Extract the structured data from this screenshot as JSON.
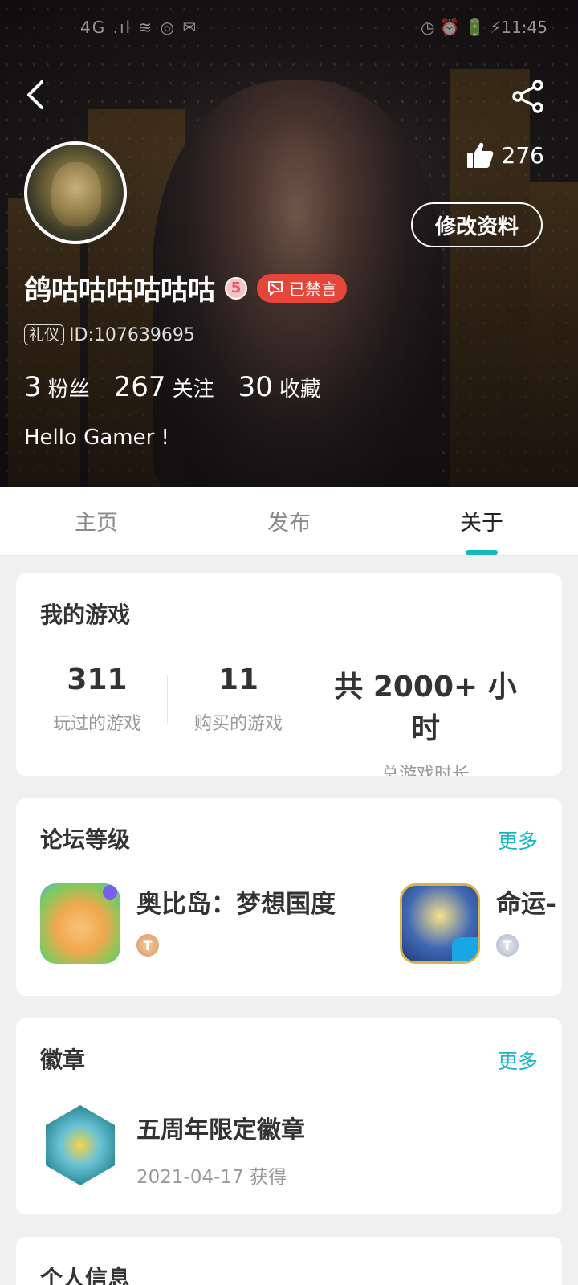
{
  "status_bar": {
    "left": "4G  .ıl  ≋  ◎  ✉",
    "right": "◷ ⏰ 🔋 ⚡11:45"
  },
  "header": {
    "likes": "276",
    "edit_label": "修改资料",
    "username": "鸽咕咕咕咕咕咕",
    "level": "5",
    "banned_label": "已禁言",
    "etiquette_tag": "礼仪",
    "user_id": "ID:107639695",
    "stats": [
      {
        "num": "3",
        "label": "粉丝"
      },
      {
        "num": "267",
        "label": "关注"
      },
      {
        "num": "30",
        "label": "收藏"
      }
    ],
    "bio": "Hello Gamer !"
  },
  "tabs": [
    {
      "label": "主页",
      "active": false
    },
    {
      "label": "发布",
      "active": false
    },
    {
      "label": "关于",
      "active": true
    }
  ],
  "my_games": {
    "title": "我的游戏",
    "stats": [
      {
        "num": "311",
        "label": "玩过的游戏"
      },
      {
        "num": "11",
        "label": "购买的游戏"
      },
      {
        "num": "共 2000+ 小时",
        "label": "总游戏时长"
      }
    ]
  },
  "forum": {
    "title": "论坛等级",
    "more": "更多",
    "items": [
      {
        "name": "奥比岛：梦想国度",
        "level": "T"
      },
      {
        "name": "命运-",
        "level": "T"
      }
    ]
  },
  "badges": {
    "title": "徽章",
    "more": "更多",
    "items": [
      {
        "name": "五周年限定徽章",
        "date": "2021-04-17 获得"
      }
    ]
  },
  "personal_info": {
    "title": "个人信息"
  },
  "colors": {
    "accent": "#16b6c2",
    "banned": "#e6453a"
  }
}
